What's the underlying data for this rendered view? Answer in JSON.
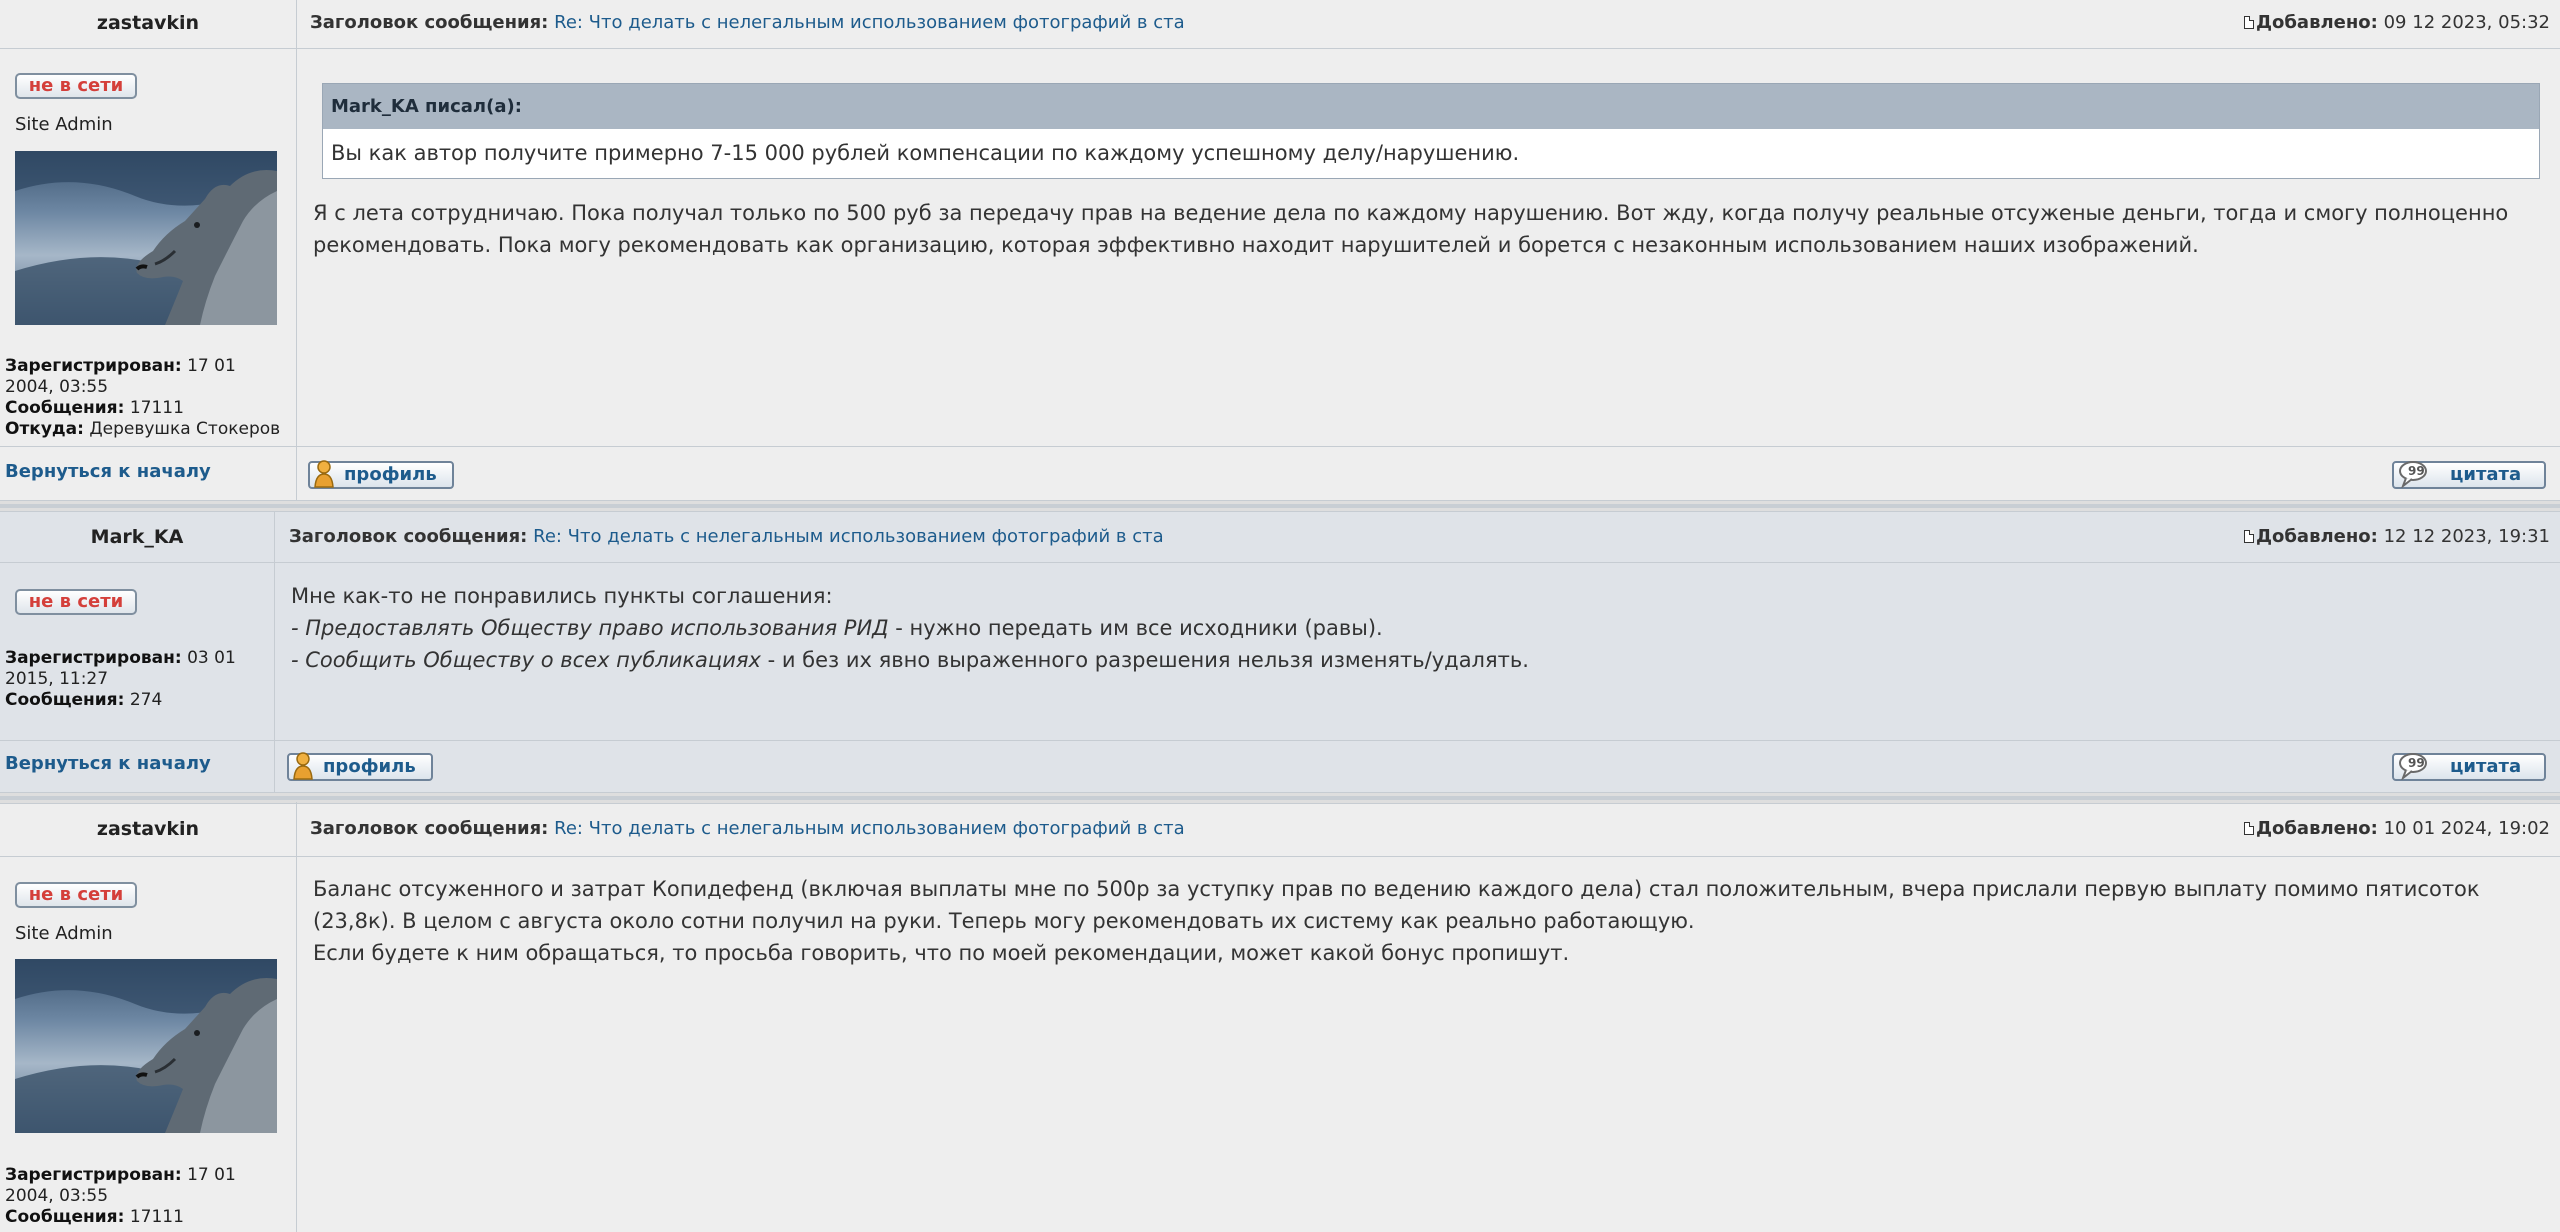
{
  "labels": {
    "subject_label": "Заголовок сообщения:",
    "date_label": "Добавлено:",
    "status": "не в сети",
    "registered_label": "Зарегистрирован:",
    "posts_label": "Сообщения:",
    "from_label": "Откуда:",
    "back_to_top": "Вернуться к началу",
    "profile_button": "профиль",
    "quote_button": "цитата"
  },
  "posts": [
    {
      "author": "zastavkin",
      "rank": "Site Admin",
      "subject": "Re: Что делать с нелегальным использованием фотографий в ста",
      "date": "09 12 2023, 05:32",
      "registered_line1": "17 01",
      "registered_line2": "2004, 03:55",
      "posts_count": "17111",
      "location": "Деревушка Стокеров",
      "quote": {
        "author_line": "Mark_KA писал(а):",
        "text": "Вы как автор получите примерно 7-15 000 рублей компенсации по каждому успешному делу/нарушению."
      },
      "body": "Я с лета сотрудничаю. Пока получал только по 500 руб за передачу прав на ведение дела по каждому нарушению. Вот жду, когда получу реальные отсуженые деньги, тогда и смогу полноценно рекомендовать. Пока могу рекомендовать как организацию, которая эффективно находит нарушителей и борется с незаконным использованием наших изображений."
    },
    {
      "author": "Mark_KA",
      "subject": "Re: Что делать с нелегальным использованием фотографий в ста",
      "date": "12 12 2023, 19:31",
      "registered_line1": "03 01",
      "registered_line2": "2015, 11:27",
      "posts_count": "274",
      "body_line1": "Мне как-то не понравились пункты соглашения:",
      "body_line2_italic": "- Предоставлять Обществу право использования РИД",
      "body_line2_rest": " - нужно передать им все исходники (равы).",
      "body_line3_italic": "- Сообщить Обществу о всех публикациях",
      "body_line3_rest": " - и без их явно выраженного разрешения нельзя изменять/удалять."
    },
    {
      "author": "zastavkin",
      "rank": "Site Admin",
      "subject": "Re: Что делать с нелегальным использованием фотографий в ста",
      "date": "10 01 2024, 19:02",
      "registered_line1": "17 01",
      "registered_line2": "2004, 03:55",
      "posts_count": "17111",
      "body_para1": "Баланс отсуженного и затрат Копидефенд (включая выплаты мне по 500р за уступку прав по ведению каждого дела) стал положительным, вчера прислали первую выплату помимо пятисоток (23,8к). В целом с августа около сотни получил на руки. Теперь могу рекомендовать их систему как реально работающую.",
      "body_para2": "Если будете к ним обращаться, то просьба говорить, что по моей рекомендации, может какой бонус пропишут."
    }
  ],
  "colors": {
    "link": "#1d5b8c",
    "offline": "#d43f3a",
    "quote_header": "#aab6c3",
    "alt_row": "#dfe3e8"
  },
  "icons": [
    "post-document-icon",
    "profile-person-icon",
    "quote-bubble-icon",
    "wolf-avatar-image"
  ]
}
